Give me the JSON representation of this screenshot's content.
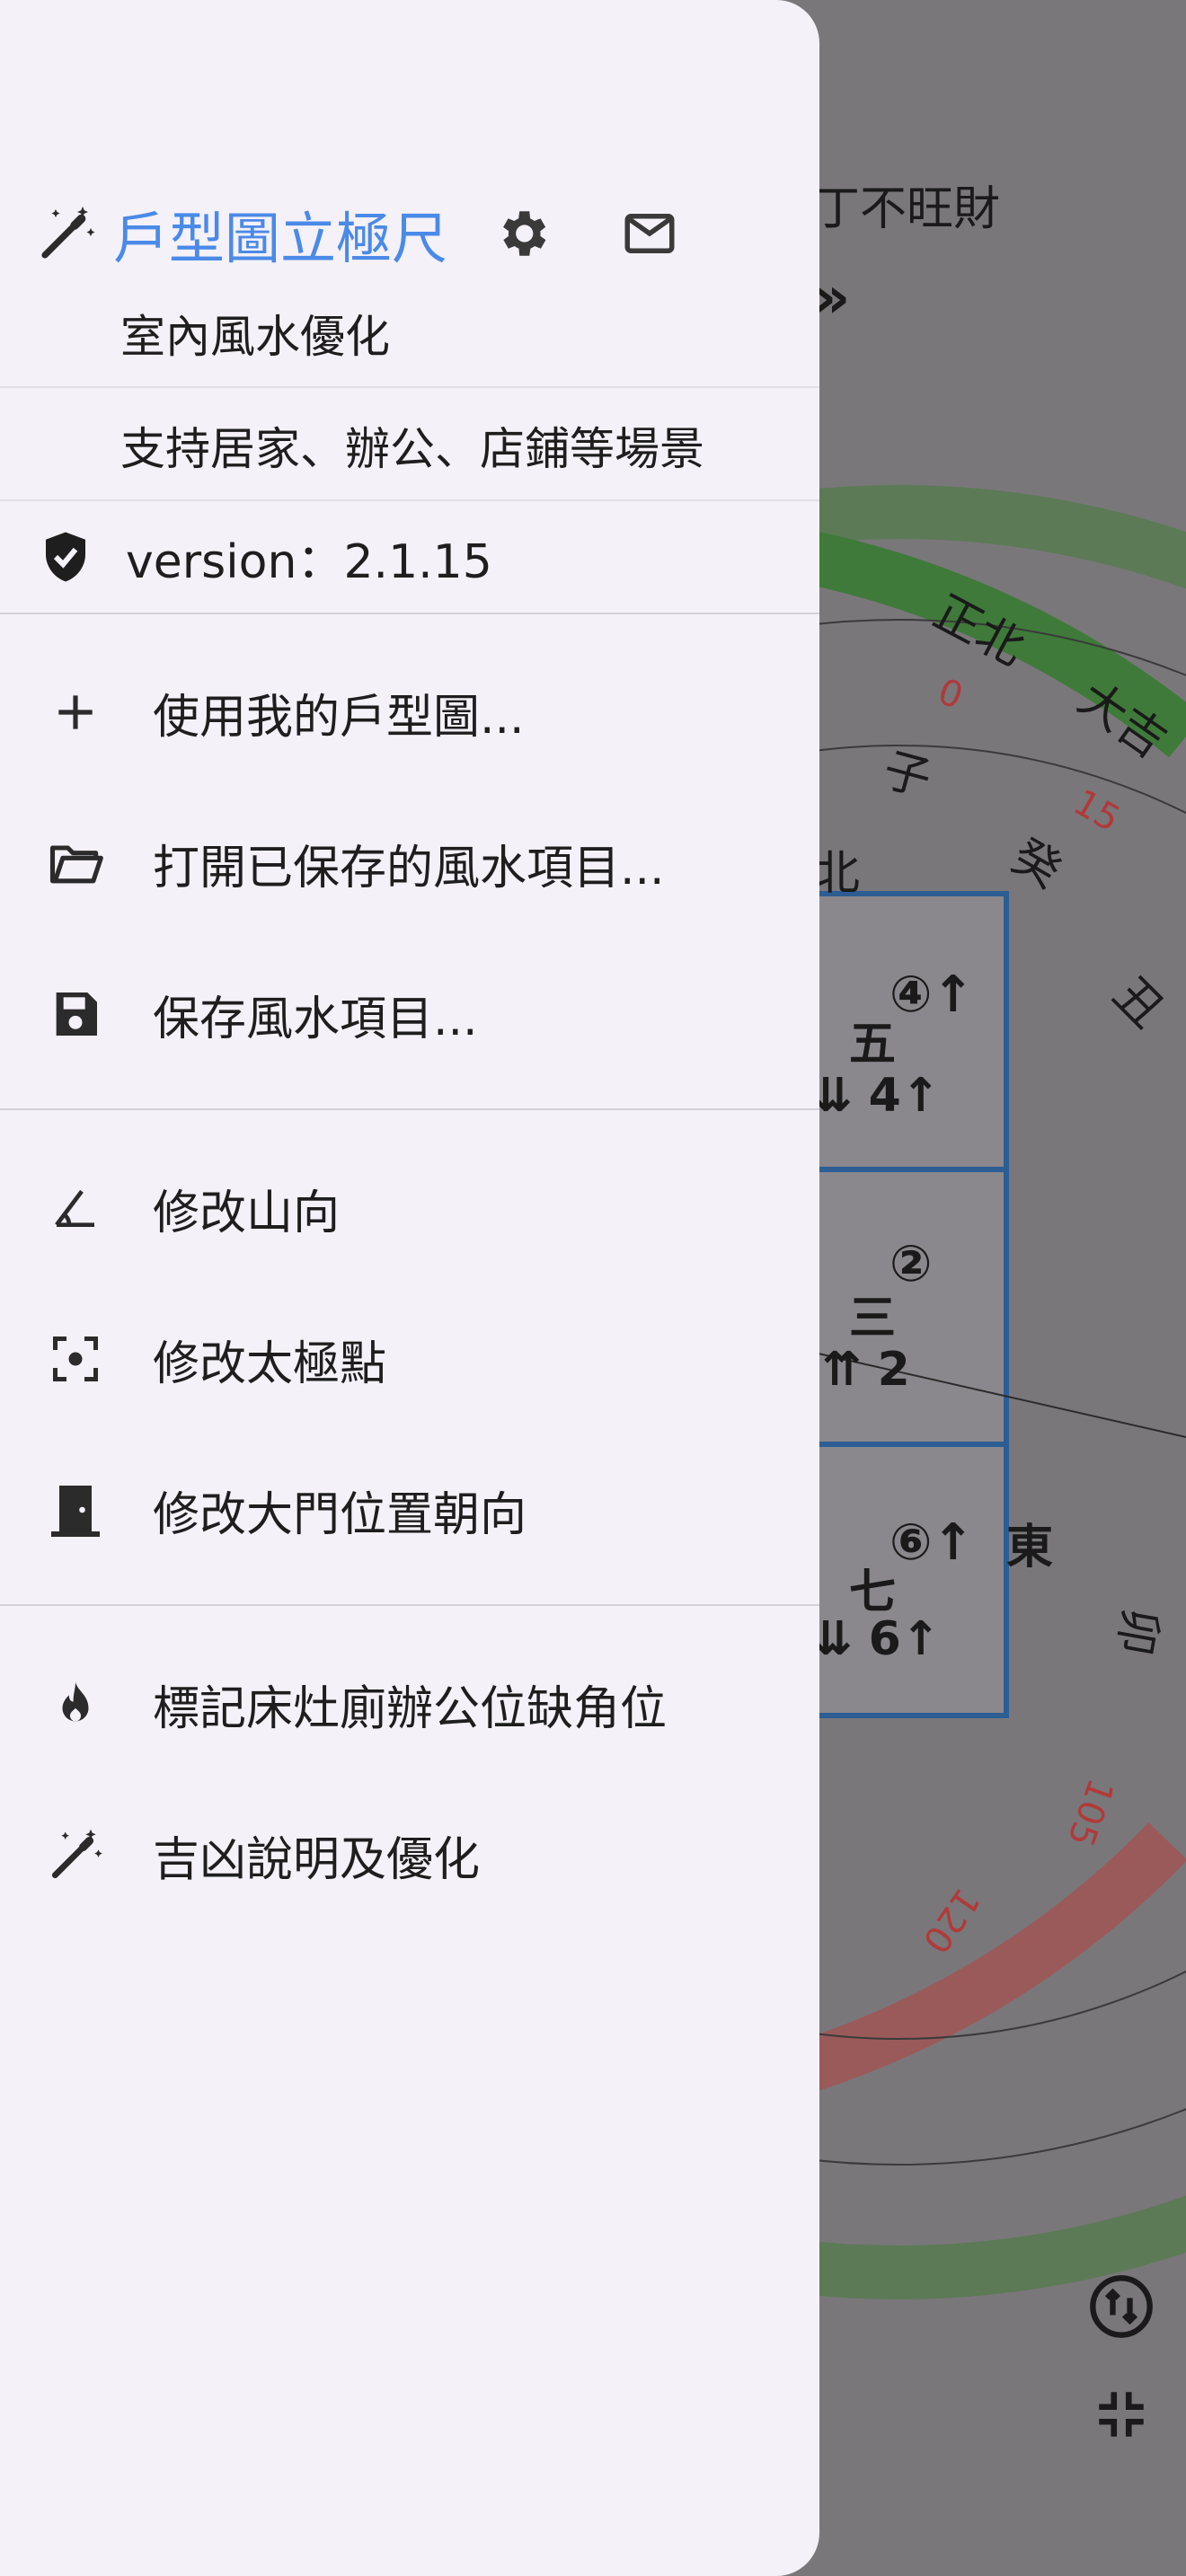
{
  "background": {
    "top_text": "丁不旺財",
    "compass_labels": [
      "正北",
      "大吉",
      "子",
      "癸",
      "丑",
      "北",
      "卯",
      "東"
    ],
    "degree_labels": [
      "0",
      "15",
      "105",
      "120"
    ],
    "palaces": [
      {
        "star": "五",
        "num": "④↑",
        "arrows": "⇊ 4↑"
      },
      {
        "star": "三",
        "num": "②",
        "arrows": "⇈ 2"
      },
      {
        "star": "七",
        "num": "⑥↑",
        "arrows": "⇊ 6↑"
      }
    ]
  },
  "drawer": {
    "app_title": "戶型圖立極尺",
    "subtitle": "室內風水優化",
    "scenarios": "支持居家、辦公、店鋪等場景",
    "version": "version：2.1.15",
    "menu_group1": [
      {
        "icon": "plus-icon",
        "label": "使用我的戶型圖..."
      },
      {
        "icon": "folder-open-icon",
        "label": "打開已保存的風水項目..."
      },
      {
        "icon": "save-icon",
        "label": "保存風水項目..."
      }
    ],
    "menu_group2": [
      {
        "icon": "angle-icon",
        "label": "修改山向"
      },
      {
        "icon": "center-focus-icon",
        "label": "修改太極點"
      },
      {
        "icon": "door-icon",
        "label": "修改大門位置朝向"
      }
    ],
    "menu_group3": [
      {
        "icon": "fire-icon",
        "label": "標記床灶廁辦公位缺角位"
      },
      {
        "icon": "magic-wand-icon",
        "label": "吉凶說明及優化"
      }
    ]
  },
  "colors": {
    "accent": "#4a8ae8",
    "drawer_bg": "#f5f1f8",
    "scrim": "#7a777b"
  }
}
